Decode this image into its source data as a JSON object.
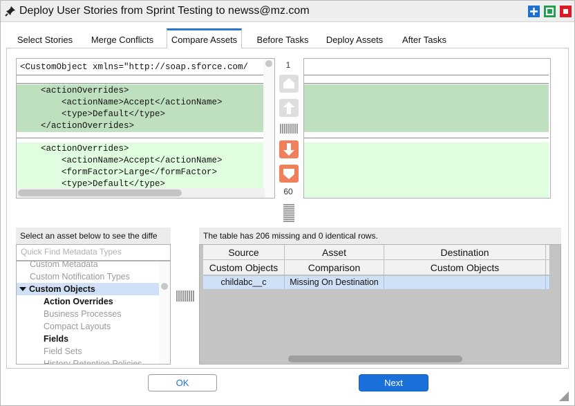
{
  "window": {
    "title": "Deploy User Stories from Sprint Testing to newss@mz.com",
    "controls": {
      "maximize_icon": "plus-icon",
      "restore_icon": "square-icon",
      "close_icon": "stop-icon"
    }
  },
  "tabs": [
    {
      "label": "Select Stories",
      "active": false
    },
    {
      "label": "Merge Conflicts",
      "active": false
    },
    {
      "label": "Compare Assets",
      "active": true
    },
    {
      "label": "Before Tasks",
      "active": false
    },
    {
      "label": "Deploy Assets",
      "active": false
    },
    {
      "label": "After Tasks",
      "active": false
    }
  ],
  "compare": {
    "left_lines": [
      "<CustomObject xmlns=\"http://soap.sforce.com/",
      "    <actionOverrides>",
      "        <actionName>Accept</actionName>",
      "        <type>Default</type>",
      "    </actionOverrides>",
      "    <actionOverrides>",
      "        <actionName>Accept</actionName>",
      "        <formFactor>Large</formFactor>",
      "        <type>Default</type>"
    ],
    "nav": {
      "top_number": "1",
      "bottom_number": "60",
      "buttons": [
        "first-diff-icon",
        "prev-diff-icon",
        "next-diff-icon",
        "last-diff-icon"
      ]
    }
  },
  "asset_panel": {
    "header": "Select an asset below to see the diffe",
    "quick_find_placeholder": "Quick Find Metadata Types",
    "items": [
      {
        "label": "Custom Metadata",
        "style": "muted"
      },
      {
        "label": "Custom Notification Types",
        "style": "muted"
      },
      {
        "label": "Custom Objects",
        "style": "selected",
        "expanded": true
      },
      {
        "label": "Action Overrides",
        "style": "bold"
      },
      {
        "label": "Business Processes",
        "style": "muted"
      },
      {
        "label": "Compact Layouts",
        "style": "muted"
      },
      {
        "label": "Fields",
        "style": "bold"
      },
      {
        "label": "Field Sets",
        "style": "muted"
      },
      {
        "label": "History Retention Policies",
        "style": "muted"
      }
    ]
  },
  "table_panel": {
    "header": "The table has 206 missing and 0 identical rows.",
    "columns": [
      "Source",
      "Asset",
      "Destination"
    ],
    "subheaders": [
      "Custom Objects",
      "Comparison",
      "Custom Objects"
    ],
    "rows": [
      [
        "childabc__c",
        "Missing On Destination",
        ""
      ]
    ]
  },
  "buttons": {
    "ok": "OK",
    "next": "Next"
  },
  "colors": {
    "accent": "#2577d1",
    "diff_changed": "#bfe0bf",
    "diff_added": "#e0fde0",
    "nav_enabled": "#f0805a",
    "selected_row": "#cfe0f7"
  }
}
